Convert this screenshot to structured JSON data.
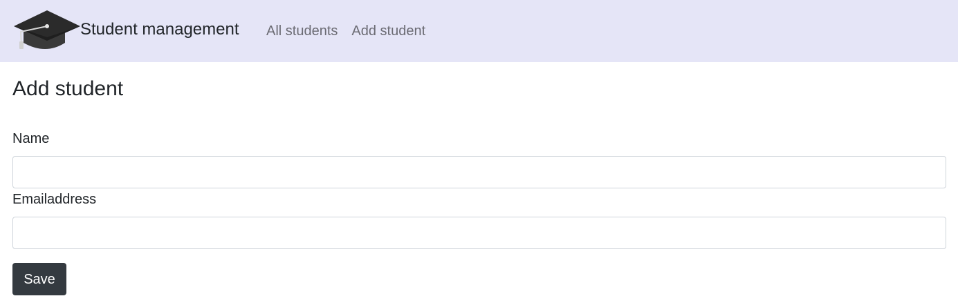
{
  "navbar": {
    "brand_icon": "graduation-cap-icon",
    "brand_text": "Student management",
    "links": [
      {
        "label": "All students"
      },
      {
        "label": "Add student"
      }
    ],
    "background_color": "#e5e5f7"
  },
  "main": {
    "title": "Add student",
    "fields": [
      {
        "label": "Name",
        "value": "",
        "placeholder": ""
      },
      {
        "label": "Emailaddress",
        "value": "",
        "placeholder": ""
      }
    ],
    "save_label": "Save",
    "button_color": "#343a40"
  }
}
